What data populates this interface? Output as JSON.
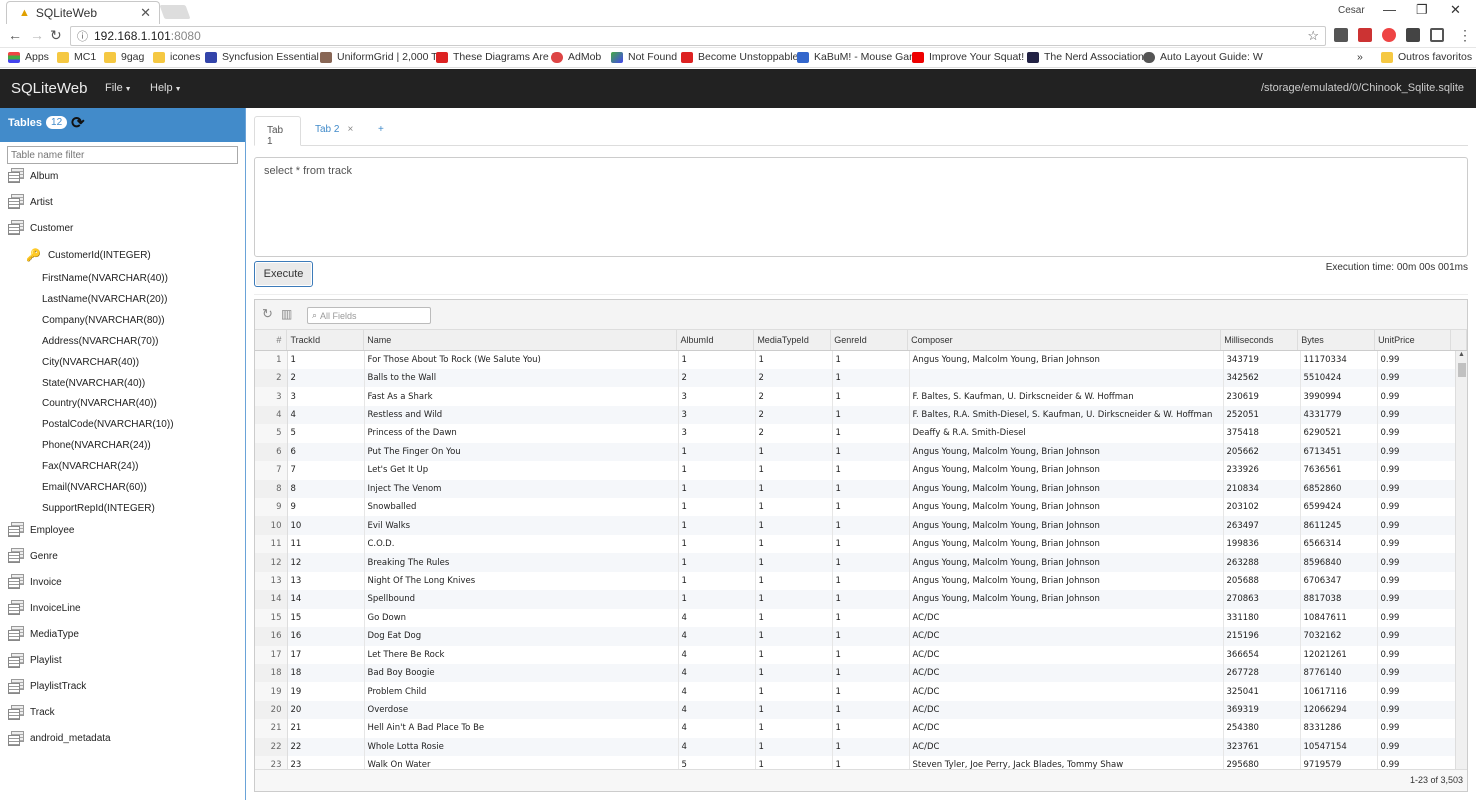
{
  "browser": {
    "tab_title": "SQLiteWeb",
    "user": "Cesar",
    "url_host": "192.168.1.101",
    "url_port": ":8080",
    "bookmarks": [
      "Apps",
      "MC1",
      "9gag",
      "icones",
      "Syncfusion Essential S",
      "UniformGrid | 2,000 T",
      "These Diagrams Are I",
      "AdMob",
      "Not Found",
      "Become Unstoppable",
      "KaBuM! - Mouse Gan",
      "Improve Your Squat!",
      "The Nerd Association",
      "Auto Layout Guide: W"
    ],
    "more_bookmarks": "»",
    "other_bookmarks": "Outros favoritos"
  },
  "navbar": {
    "brand": "SQLiteWeb",
    "menu_file": "File",
    "menu_help": "Help",
    "db_path": "/storage/emulated/0/Chinook_Sqlite.sqlite"
  },
  "sidebar": {
    "title": "Tables",
    "count": "12",
    "filter_placeholder": "Table name filter",
    "tables_top": [
      "Album",
      "Artist",
      "Customer"
    ],
    "pk_column": "CustomerId(INTEGER)",
    "columns": [
      "FirstName(NVARCHAR(40))",
      "LastName(NVARCHAR(20))",
      "Company(NVARCHAR(80))",
      "Address(NVARCHAR(70))",
      "City(NVARCHAR(40))",
      "State(NVARCHAR(40))",
      "Country(NVARCHAR(40))",
      "PostalCode(NVARCHAR(10))",
      "Phone(NVARCHAR(24))",
      "Fax(NVARCHAR(24))",
      "Email(NVARCHAR(60))",
      "SupportRepId(INTEGER)"
    ],
    "tables_bottom": [
      "Employee",
      "Genre",
      "Invoice",
      "InvoiceLine",
      "MediaType",
      "Playlist",
      "PlaylistTrack",
      "Track",
      "android_metadata"
    ]
  },
  "tabs": {
    "tab1": "Tab 1",
    "tab2": "Tab 2",
    "close": "×",
    "add": "+"
  },
  "query": {
    "sql": "select * from track",
    "execute_label": "Execute",
    "exec_time": "Execution time: 00m 00s 001ms"
  },
  "grid": {
    "search_placeholder": "All Fields",
    "headers": [
      "#",
      "TrackId",
      "Name",
      "AlbumId",
      "MediaTypeId",
      "GenreId",
      "Composer",
      "Milliseconds",
      "Bytes",
      "UnitPrice"
    ],
    "rows": [
      [
        "1",
        "1",
        "For Those About To Rock (We Salute You)",
        "1",
        "1",
        "1",
        "Angus Young, Malcolm Young, Brian Johnson",
        "343719",
        "11170334",
        "0.99"
      ],
      [
        "2",
        "2",
        "Balls to the Wall",
        "2",
        "2",
        "1",
        "",
        "342562",
        "5510424",
        "0.99"
      ],
      [
        "3",
        "3",
        "Fast As a Shark",
        "3",
        "2",
        "1",
        "F. Baltes, S. Kaufman, U. Dirkscneider & W. Hoffman",
        "230619",
        "3990994",
        "0.99"
      ],
      [
        "4",
        "4",
        "Restless and Wild",
        "3",
        "2",
        "1",
        "F. Baltes, R.A. Smith-Diesel, S. Kaufman, U. Dirkscneider & W. Hoffman",
        "252051",
        "4331779",
        "0.99"
      ],
      [
        "5",
        "5",
        "Princess of the Dawn",
        "3",
        "2",
        "1",
        "Deaffy & R.A. Smith-Diesel",
        "375418",
        "6290521",
        "0.99"
      ],
      [
        "6",
        "6",
        "Put The Finger On You",
        "1",
        "1",
        "1",
        "Angus Young, Malcolm Young, Brian Johnson",
        "205662",
        "6713451",
        "0.99"
      ],
      [
        "7",
        "7",
        "Let's Get It Up",
        "1",
        "1",
        "1",
        "Angus Young, Malcolm Young, Brian Johnson",
        "233926",
        "7636561",
        "0.99"
      ],
      [
        "8",
        "8",
        "Inject The Venom",
        "1",
        "1",
        "1",
        "Angus Young, Malcolm Young, Brian Johnson",
        "210834",
        "6852860",
        "0.99"
      ],
      [
        "9",
        "9",
        "Snowballed",
        "1",
        "1",
        "1",
        "Angus Young, Malcolm Young, Brian Johnson",
        "203102",
        "6599424",
        "0.99"
      ],
      [
        "10",
        "10",
        "Evil Walks",
        "1",
        "1",
        "1",
        "Angus Young, Malcolm Young, Brian Johnson",
        "263497",
        "8611245",
        "0.99"
      ],
      [
        "11",
        "11",
        "C.O.D.",
        "1",
        "1",
        "1",
        "Angus Young, Malcolm Young, Brian Johnson",
        "199836",
        "6566314",
        "0.99"
      ],
      [
        "12",
        "12",
        "Breaking The Rules",
        "1",
        "1",
        "1",
        "Angus Young, Malcolm Young, Brian Johnson",
        "263288",
        "8596840",
        "0.99"
      ],
      [
        "13",
        "13",
        "Night Of The Long Knives",
        "1",
        "1",
        "1",
        "Angus Young, Malcolm Young, Brian Johnson",
        "205688",
        "6706347",
        "0.99"
      ],
      [
        "14",
        "14",
        "Spellbound",
        "1",
        "1",
        "1",
        "Angus Young, Malcolm Young, Brian Johnson",
        "270863",
        "8817038",
        "0.99"
      ],
      [
        "15",
        "15",
        "Go Down",
        "4",
        "1",
        "1",
        "AC/DC",
        "331180",
        "10847611",
        "0.99"
      ],
      [
        "16",
        "16",
        "Dog Eat Dog",
        "4",
        "1",
        "1",
        "AC/DC",
        "215196",
        "7032162",
        "0.99"
      ],
      [
        "17",
        "17",
        "Let There Be Rock",
        "4",
        "1",
        "1",
        "AC/DC",
        "366654",
        "12021261",
        "0.99"
      ],
      [
        "18",
        "18",
        "Bad Boy Boogie",
        "4",
        "1",
        "1",
        "AC/DC",
        "267728",
        "8776140",
        "0.99"
      ],
      [
        "19",
        "19",
        "Problem Child",
        "4",
        "1",
        "1",
        "AC/DC",
        "325041",
        "10617116",
        "0.99"
      ],
      [
        "20",
        "20",
        "Overdose",
        "4",
        "1",
        "1",
        "AC/DC",
        "369319",
        "12066294",
        "0.99"
      ],
      [
        "21",
        "21",
        "Hell Ain't A Bad Place To Be",
        "4",
        "1",
        "1",
        "AC/DC",
        "254380",
        "8331286",
        "0.99"
      ],
      [
        "22",
        "22",
        "Whole Lotta Rosie",
        "4",
        "1",
        "1",
        "AC/DC",
        "323761",
        "10547154",
        "0.99"
      ],
      [
        "23",
        "23",
        "Walk On Water",
        "5",
        "1",
        "1",
        "Steven Tyler, Joe Perry, Jack Blades, Tommy Shaw",
        "295680",
        "9719579",
        "0.99"
      ]
    ],
    "record_count": "1-23 of 3,503"
  },
  "colors": {
    "navbar_bg": "#222222",
    "sidebar_header": "#428bca",
    "link": "#428bca"
  }
}
